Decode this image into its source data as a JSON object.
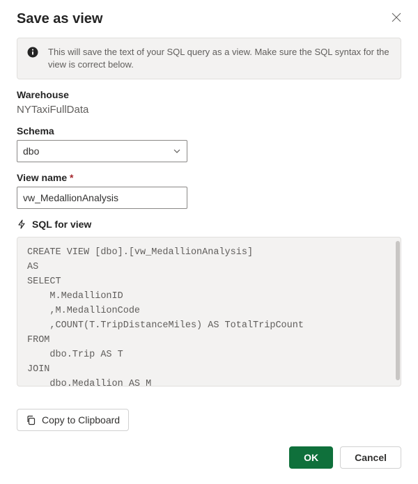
{
  "dialog": {
    "title": "Save as view",
    "info": "This will save the text of your SQL query as a view. Make sure the SQL syntax for the view is correct below."
  },
  "warehouse": {
    "label": "Warehouse",
    "value": "NYTaxiFullData"
  },
  "schema": {
    "label": "Schema",
    "selected": "dbo"
  },
  "viewName": {
    "label": "View name",
    "requiredMark": "*",
    "value": "vw_MedallionAnalysis"
  },
  "sql": {
    "label": "SQL for view",
    "code": "CREATE VIEW [dbo].[vw_MedallionAnalysis]\nAS\nSELECT\n    M.MedallionID\n    ,M.MedallionCode\n    ,COUNT(T.TripDistanceMiles) AS TotalTripCount\nFROM\n    dbo.Trip AS T\nJOIN\n    dbo.Medallion AS M"
  },
  "buttons": {
    "copy": "Copy to Clipboard",
    "ok": "OK",
    "cancel": "Cancel"
  }
}
